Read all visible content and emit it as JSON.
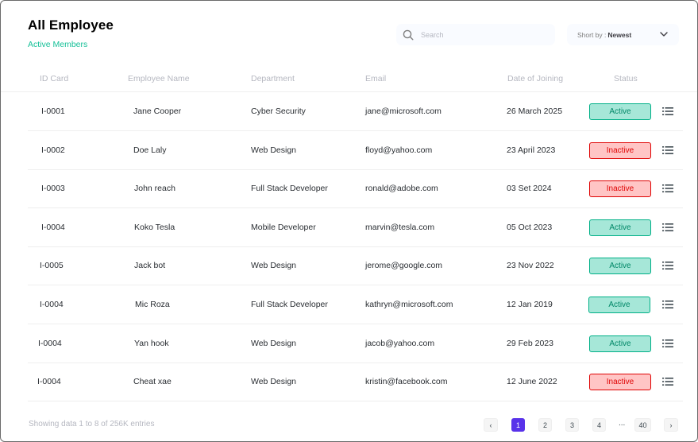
{
  "header": {
    "title": "All Employee",
    "subtitle": "Active Members",
    "search_placeholder": "Search",
    "sort_label": "Short by :",
    "sort_value": "Newest"
  },
  "columns": [
    "ID Card",
    "Employee Name",
    "Department",
    "Email",
    "Date of Joining",
    "Status"
  ],
  "rows": [
    {
      "id": "I-0001",
      "name": "Jane Cooper",
      "department": "Cyber Security",
      "email": "jane@microsoft.com",
      "date": "26 March 2025",
      "status": "Active"
    },
    {
      "id": "I-0002",
      "name": "Doe Laly",
      "department": "Web Design",
      "email": "floyd@yahoo.com",
      "date": "23 April 2023",
      "status": "Inactive"
    },
    {
      "id": "I-0003",
      "name": "John reach",
      "department": "Full Stack Developer",
      "email": "ronald@adobe.com",
      "date": "03 Set 2024",
      "status": "Inactive"
    },
    {
      "id": "I-0004",
      "name": "Koko Tesla",
      "department": "Mobile Developer",
      "email": "marvin@tesla.com",
      "date": "05 Oct 2023",
      "status": "Active"
    },
    {
      "id": "I-0005",
      "name": "Jack bot",
      "department": "Web Design",
      "email": "jerome@google.com",
      "date": "23 Nov 2022",
      "status": "Active"
    },
    {
      "id": "I-0004",
      "name": "Mic Roza",
      "department": "Full Stack Developer",
      "email": "kathryn@microsoft.com",
      "date": "12 Jan 2019",
      "status": "Active"
    },
    {
      "id": "I-0004",
      "name": "Yan hook",
      "department": "Web Design",
      "email": "jacob@yahoo.com",
      "date": "29 Feb 2023",
      "status": "Active"
    },
    {
      "id": "I-0004",
      "name": "Cheat xae",
      "department": "Web Design",
      "email": "kristin@facebook.com",
      "date": "12 June 2022",
      "status": "Inactive"
    }
  ],
  "footer": {
    "summary": "Showing data 1 to 8 of  256K entries",
    "prev": "‹",
    "next": "›",
    "pages": [
      "1",
      "2",
      "3",
      "4"
    ],
    "current_page": "1",
    "ellipsis": "...",
    "last_page": "40"
  },
  "icons": {
    "search": "search-icon",
    "sort": "chevron-down-icon",
    "row_menu": "list-icon"
  },
  "colors": {
    "accent": "#5932ea",
    "subtitle": "#16c098",
    "active_bg": "#a6e7d8",
    "active_text": "#008767",
    "inactive_bg": "#ffc5c5",
    "inactive_text": "#df0404"
  }
}
